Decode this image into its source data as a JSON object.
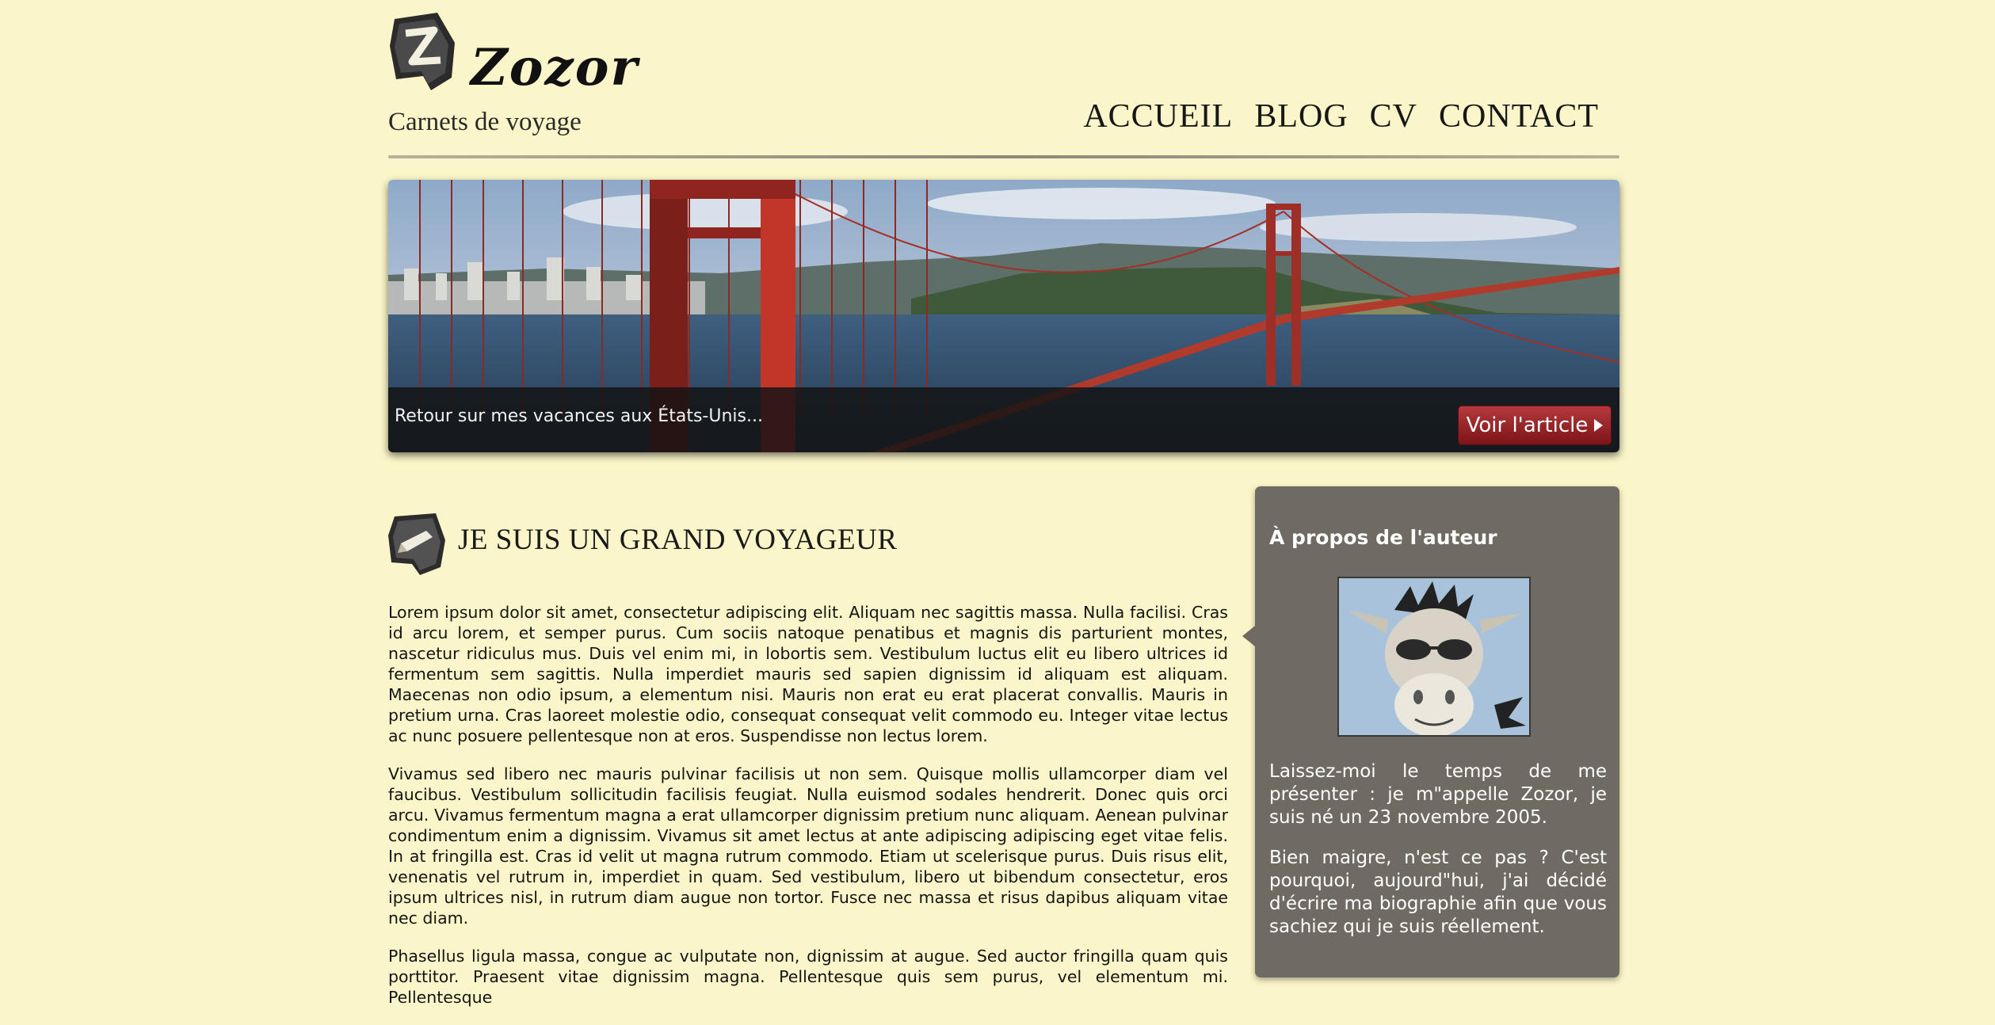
{
  "header": {
    "site_title": "Zozor",
    "tagline": "Carnets de voyage",
    "logo_icon": "zozor-logo-icon"
  },
  "nav": {
    "items": [
      {
        "label": "ACCUEIL"
      },
      {
        "label": "BLOG"
      },
      {
        "label": "CV"
      },
      {
        "label": "CONTACT"
      }
    ]
  },
  "banner": {
    "caption": "Retour sur mes vacances aux États-Unis...",
    "button_label": "Voir l'article",
    "button_icon": "triangle-right-icon",
    "image": "golden-gate-bridge-photo"
  },
  "article": {
    "icon": "pencil-badge-icon",
    "title": "JE SUIS UN GRAND VOYAGEUR",
    "paragraphs": [
      "Lorem ipsum dolor sit amet, consectetur adipiscing elit. Aliquam nec sagittis massa. Nulla facilisi. Cras id arcu lorem, et semper purus. Cum sociis natoque penatibus et magnis dis parturient montes, nascetur ridiculus mus. Duis vel enim mi, in lobortis sem. Vestibulum luctus elit eu libero ultrices id fermentum sem sagittis. Nulla imperdiet mauris sed sapien dignissim id aliquam est aliquam. Maecenas non odio ipsum, a elementum nisi. Mauris non erat eu erat placerat convallis. Mauris in pretium urna. Cras laoreet molestie odio, consequat consequat velit commodo eu. Integer vitae lectus ac nunc posuere pellentesque non at eros. Suspendisse non lectus lorem.",
      "Vivamus sed libero nec mauris pulvinar facilisis ut non sem. Quisque mollis ullamcorper diam vel faucibus. Vestibulum sollicitudin facilisis feugiat. Nulla euismod sodales hendrerit. Donec quis orci arcu. Vivamus fermentum magna a erat ullamcorper dignissim pretium nunc aliquam. Aenean pulvinar condimentum enim a dignissim. Vivamus sit amet lectus at ante adipiscing adipiscing eget vitae felis. In at fringilla est. Cras id velit ut magna rutrum commodo. Etiam ut scelerisque purus. Duis risus elit, venenatis vel rutrum in, imperdiet in quam. Sed vestibulum, libero ut bibendum consectetur, eros ipsum ultrices nisl, in rutrum diam augue non tortor. Fusce nec massa et risus dapibus aliquam vitae nec diam.",
      "Phasellus ligula massa, congue ac vulputate non, dignissim at augue. Sed auctor fringilla quam quis porttitor. Praesent vitae dignissim magna. Pellentesque quis sem purus, vel elementum mi. Pellentesque"
    ]
  },
  "sidebar": {
    "title": "À propos de l'auteur",
    "avatar": "zozor-donkey-avatar",
    "paragraphs": [
      "Laissez-moi le temps de me présenter : je m\"appelle Zozor, je suis né un 23 novembre 2005.",
      "Bien maigre, n'est ce pas ? C'est pourquoi, aujourd\"hui, j'ai décidé d'écrire ma biographie afin que vous sachiez qui je suis réellement."
    ]
  },
  "colors": {
    "page_background": "#fbf6c9",
    "sidebar_background": "#706b62",
    "button_red": "#9c2226",
    "banner_overlay": "#121212"
  }
}
